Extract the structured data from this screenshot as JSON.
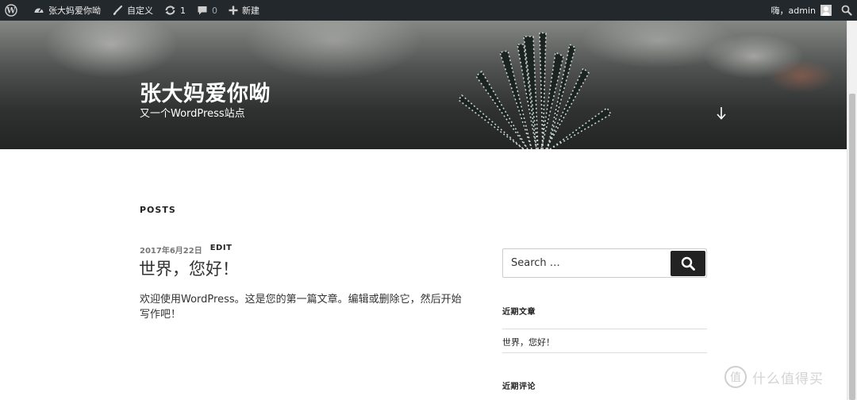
{
  "adminbar": {
    "site_name": "张大妈爱你呦",
    "customize_label": "自定义",
    "updates_count": "1",
    "comments_count": "0",
    "new_label": "新建",
    "greeting": "嗨，admin",
    "icons": {
      "wp": "wordpress-logo-icon",
      "site": "dashboard-gauge-icon",
      "customize": "paintbrush-icon",
      "updates": "refresh-icon",
      "comments": "speech-bubble-icon",
      "new": "plus-icon",
      "avatar": "user-avatar-icon",
      "search": "search-icon"
    }
  },
  "header": {
    "title": "张大妈爱你呦",
    "description": "又一个WordPress站点"
  },
  "main": {
    "posts_heading": "POSTS",
    "post": {
      "date": "2017年6月22日",
      "edit_label": "EDIT",
      "title": "世界，您好！",
      "excerpt": "欢迎使用WordPress。这是您的第一篇文章。编辑或删除它，然后开始写作吧！"
    }
  },
  "sidebar": {
    "search_placeholder": "Search …",
    "recent_posts_title": "近期文章",
    "recent_posts": [
      "世界，您好！"
    ],
    "recent_comments_title": "近期评论"
  },
  "watermark": {
    "text": "什么值得买",
    "logo_glyph": "值"
  }
}
